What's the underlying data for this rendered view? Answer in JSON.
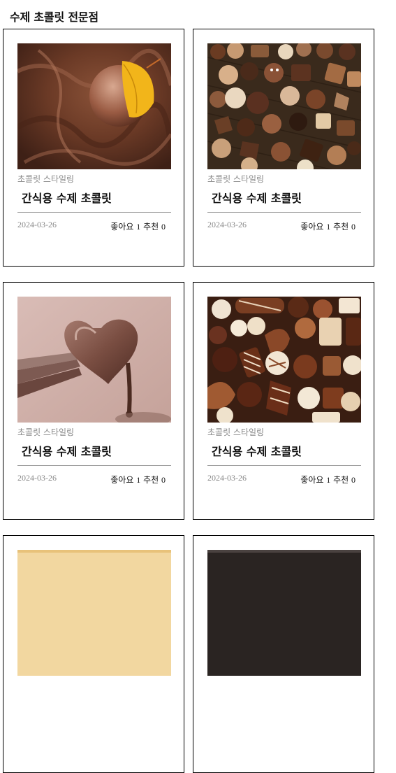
{
  "header": {
    "title": "수제 초콜릿 전문점"
  },
  "cards": [
    {
      "category": "초콜릿 스타일링",
      "name": "간식용 수제 초콜릿",
      "date": "2024-03-26",
      "likes_label": "좋아요",
      "likes": "1",
      "recommend_label": "추천",
      "recommend": "0",
      "image": "melted-chocolate-with-yellow-petal"
    },
    {
      "category": "초콜릿 스타일링",
      "name": "간식용 수제 초콜릿",
      "date": "2024-03-26",
      "likes_label": "좋아요",
      "likes": "1",
      "recommend_label": "추천",
      "recommend": "0",
      "image": "assorted-chocolates-on-wood"
    },
    {
      "category": "초콜릿 스타일링",
      "name": "간식용 수제 초콜릿",
      "date": "2024-03-26",
      "likes_label": "좋아요",
      "likes": "1",
      "recommend_label": "추천",
      "recommend": "0",
      "image": "heart-chocolate-dipped-on-fork"
    },
    {
      "category": "초콜릿 스타일링",
      "name": "간식용 수제 초콜릿",
      "date": "2024-03-26",
      "likes_label": "좋아요",
      "likes": "1",
      "recommend_label": "추천",
      "recommend": "0",
      "image": "pile-of-praline-chocolates"
    },
    {
      "image": "yellow-dessert-partial"
    },
    {
      "image": "dark-chocolate-partial"
    }
  ]
}
